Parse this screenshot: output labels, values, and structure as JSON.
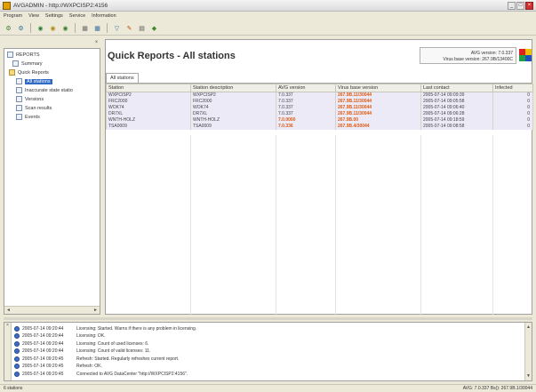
{
  "window": {
    "title": "AVGADMIN - http://WXPCISP2:4156",
    "buttons": [
      "_",
      "□",
      "×"
    ]
  },
  "menu": [
    "Program",
    "View",
    "Settings",
    "Service",
    "Information"
  ],
  "toolbar": {
    "icons": [
      {
        "name": "connect-icon",
        "glyph": "⚙",
        "color": "#3a7d2a"
      },
      {
        "name": "disconnect-icon",
        "glyph": "⚙",
        "color": "#2a6e9e"
      },
      {
        "name": "scan-icon",
        "glyph": "◉",
        "color": "#2f7f3a"
      },
      {
        "name": "update-icon",
        "glyph": "◉",
        "color": "#b58a1a"
      },
      {
        "name": "settings-icon",
        "glyph": "◉",
        "color": "#3a7d2a"
      },
      {
        "name": "policy-icon",
        "glyph": "▦",
        "color": "#6a6a6a"
      },
      {
        "name": "groups-icon",
        "glyph": "▦",
        "color": "#3a6ea0"
      },
      {
        "name": "filter-icon",
        "glyph": "▽",
        "color": "#3a6ea0"
      },
      {
        "name": "report-icon",
        "glyph": "✎",
        "color": "#c04a1a"
      },
      {
        "name": "print-icon",
        "glyph": "▤",
        "color": "#555555"
      },
      {
        "name": "refresh-icon",
        "glyph": "◆",
        "color": "#3a8a2a"
      }
    ]
  },
  "tree": {
    "items": [
      {
        "label": "REPORTS",
        "icon": "reports-icon",
        "kind": "doc"
      },
      {
        "label": "Summary",
        "icon": "summary-icon",
        "kind": "doc"
      },
      {
        "label": "Quick Reports",
        "icon": "quick-reports-icon",
        "kind": "folder"
      },
      {
        "label": "All stations",
        "icon": "stations-icon",
        "kind": "doc",
        "selected": true
      },
      {
        "label": "Inaccurate state statio",
        "icon": "warning-icon",
        "kind": "doc"
      },
      {
        "label": "Versions",
        "icon": "versions-icon",
        "kind": "doc"
      },
      {
        "label": "Scan results",
        "icon": "scan-results-icon",
        "kind": "doc"
      },
      {
        "label": "Events",
        "icon": "events-icon",
        "kind": "doc"
      }
    ],
    "scroll_left": "◄",
    "scroll_right": "►"
  },
  "main": {
    "title": "Quick Reports - All stations",
    "version_line1": "AVG version: 7.0.337",
    "version_line2": "Virus base version: 267.9B/13400C",
    "tab": "All stations",
    "columns": [
      "Station",
      "Station description",
      "AVG version",
      "Virus base version",
      "Last contact",
      "Infected"
    ],
    "rows": [
      {
        "station": "WXPCISP2",
        "desc": "WXPCISP2",
        "avg": "7.0.337",
        "avg_warn": false,
        "virus": "267.9B.11/30044",
        "contact": "2005-07-14 09:09:39",
        "infected": "0"
      },
      {
        "station": "FRC2000",
        "desc": "FRC2000",
        "avg": "7.0.337",
        "avg_warn": false,
        "virus": "267.9B.11/30044",
        "contact": "2005-07-14 09:05:58",
        "infected": "0"
      },
      {
        "station": "WOK74",
        "desc": "WOK74",
        "avg": "7.0.337",
        "avg_warn": false,
        "virus": "267.9B.11/30044",
        "contact": "2005-07-14 09:06:40",
        "infected": "0"
      },
      {
        "station": "DR7XL",
        "desc": "DR7XL",
        "avg": "7.0.337",
        "avg_warn": false,
        "virus": "267.9B.11/30044",
        "contact": "2005-07-14 09:06:28",
        "infected": "0"
      },
      {
        "station": "WNTH-HOLZ",
        "desc": "WNTH-HOLZ",
        "avg": "7.0.0000",
        "avg_warn": true,
        "virus": "267.9B.00",
        "contact": "2005-07-14 09:18:59",
        "infected": "0"
      },
      {
        "station": "TSA0009",
        "desc": "TSA0009",
        "avg": "7.0.336",
        "avg_warn": true,
        "virus": "267.9B.4/30044",
        "contact": "2005-07-14 09:08:58",
        "infected": "0"
      }
    ]
  },
  "log": {
    "lines": [
      {
        "ts": "2005-07-14 09:20:44",
        "msg": "Licensing: Started. Warns if there is any problem in licensing."
      },
      {
        "ts": "2005-07-14 09:20:44",
        "msg": "Licensing: OK."
      },
      {
        "ts": "2005-07-14 09:20:44",
        "msg": "Licensing: Count of used licenses: 6."
      },
      {
        "ts": "2005-07-14 09:20:44",
        "msg": "Licensing: Count of valid licenses: 11."
      },
      {
        "ts": "2005-07-14 09:20:45",
        "msg": "Refresh: Started. Regularly refreshes current report."
      },
      {
        "ts": "2005-07-14 09:20:45",
        "msg": "Refresh: OK."
      },
      {
        "ts": "2005-07-14 09:20:45",
        "msg": "Connected to AVG DataCenter \"http://WXPCISP2:4156\"."
      }
    ]
  },
  "status": {
    "left": "6 stations",
    "right": "AVG: 7.0.337   Bs(): 267.9B.1/30044"
  }
}
